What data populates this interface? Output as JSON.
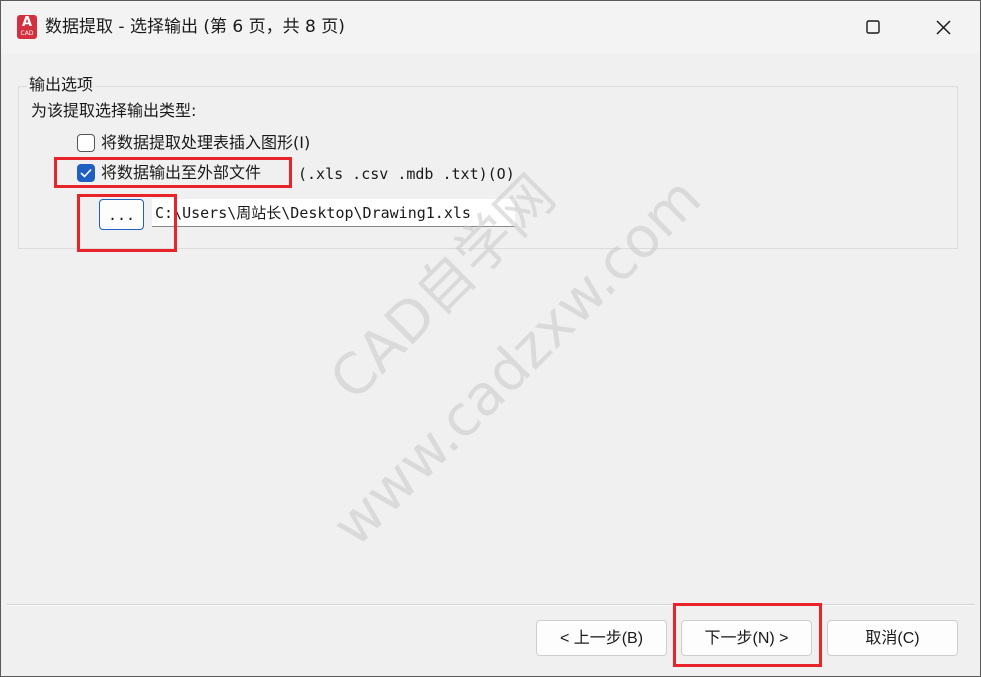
{
  "window": {
    "title": "数据提取 - 选择输出 (第 6 页，共 8 页)",
    "app_icon_letter": "A",
    "app_icon_sub": "CAD"
  },
  "options_group": {
    "title": "输出选项",
    "prompt": "为该提取选择输出类型:",
    "option_insert_table": {
      "label": "将数据提取处理表插入图形(I)",
      "checked": false
    },
    "option_external_file": {
      "label": "将数据输出至外部文件",
      "ext_label": "(.xls .csv .mdb .txt)(O)",
      "checked": true
    },
    "browse_button_label": "...",
    "file_path": "C:\\Users\\周站长\\Desktop\\Drawing1.xls"
  },
  "buttons": {
    "prev": "< 上一步(B)",
    "next": "下一步(N) >",
    "cancel": "取消(C)"
  },
  "watermark": {
    "line1": "CAD自学网",
    "line2": "www.cadzxw.com"
  },
  "colors": {
    "accent": "#1f5fbf",
    "highlight": "#e8242a",
    "app_icon": "#d32f3f"
  }
}
